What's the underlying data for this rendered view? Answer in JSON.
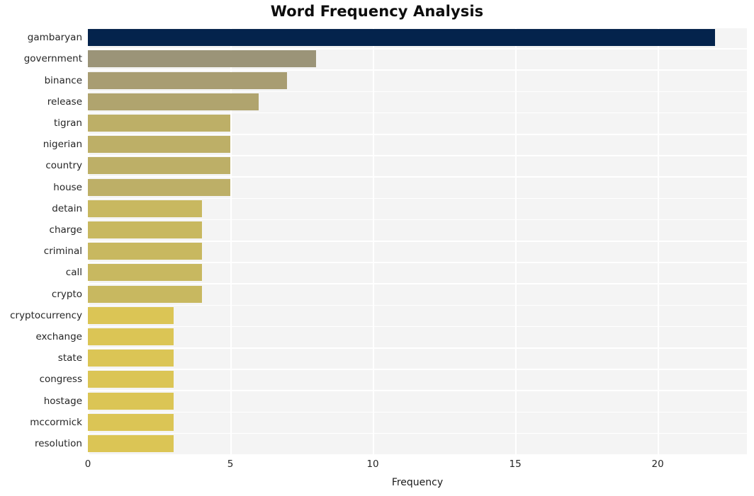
{
  "chart_data": {
    "type": "bar",
    "orientation": "horizontal",
    "title": "Word Frequency Analysis",
    "xlabel": "Frequency",
    "ylabel": "",
    "categories": [
      "gambaryan",
      "government",
      "binance",
      "release",
      "tigran",
      "nigerian",
      "country",
      "house",
      "detain",
      "charge",
      "criminal",
      "call",
      "crypto",
      "cryptocurrency",
      "exchange",
      "state",
      "congress",
      "hostage",
      "mccormick",
      "resolution"
    ],
    "values": [
      22,
      8,
      7,
      6,
      5,
      5,
      5,
      5,
      4,
      4,
      4,
      4,
      4,
      3,
      3,
      3,
      3,
      3,
      3,
      3
    ],
    "bar_colors": [
      "#04234c",
      "#9b9478",
      "#a89d72",
      "#b0a46e",
      "#bdaf67",
      "#bdaf67",
      "#bdaf67",
      "#bdaf67",
      "#c8b860",
      "#c8b860",
      "#c8b860",
      "#c8b860",
      "#c8b860",
      "#dbc555",
      "#dbc555",
      "#dbc555",
      "#dbc555",
      "#dbc555",
      "#dbc555",
      "#dbc555"
    ],
    "xticks": [
      0,
      5,
      10,
      15,
      20
    ],
    "xtick_labels": [
      "0",
      "5",
      "10",
      "15",
      "20"
    ],
    "xlim": [
      0,
      23.13
    ],
    "grid": true,
    "grid_color": "#ffffff",
    "plot_background": "#f4f4f4",
    "figure_background": "#ffffff",
    "legend": null
  }
}
